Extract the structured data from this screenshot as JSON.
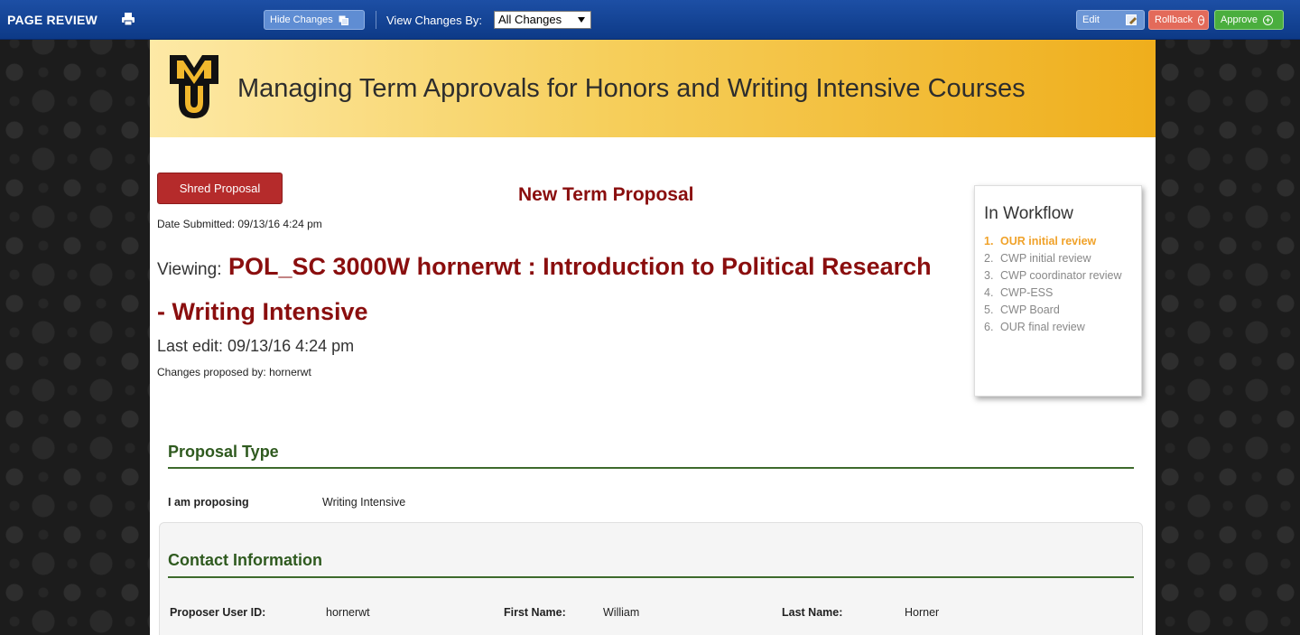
{
  "toolbar": {
    "title": "PAGE REVIEW",
    "hide_changes_label": "Hide Changes",
    "view_changes_label": "View Changes By:",
    "view_changes_selected": "All Changes",
    "edit_label": "Edit",
    "rollback_label": "Rollback",
    "approve_label": "Approve"
  },
  "banner": {
    "title": "Managing Term Approvals for Honors and Writing Intensive Courses"
  },
  "proposal": {
    "shred_label": "Shred Proposal",
    "heading": "New Term Proposal",
    "date_submitted": "Date Submitted: 09/13/16 4:24 pm",
    "viewing_label": "Viewing:",
    "viewing_title": "POL_SC 3000W hornerwt : Introduction to Political Research - Writing Intensive",
    "last_edit": "Last edit: 09/13/16 4:24 pm",
    "changes_by": "Changes proposed by: hornerwt"
  },
  "workflow": {
    "title": "In Workflow",
    "steps": [
      {
        "num": "1.",
        "label": "OUR initial review",
        "active": true
      },
      {
        "num": "2.",
        "label": "CWP initial review",
        "active": false
      },
      {
        "num": "3.",
        "label": "CWP coordinator review",
        "active": false
      },
      {
        "num": "4.",
        "label": "CWP-ESS",
        "active": false
      },
      {
        "num": "5.",
        "label": "CWP Board",
        "active": false
      },
      {
        "num": "6.",
        "label": "OUR final review",
        "active": false
      }
    ]
  },
  "proposal_type": {
    "heading": "Proposal Type",
    "label": "I am proposing",
    "value": "Writing Intensive"
  },
  "contact": {
    "heading": "Contact Information",
    "user_id_label": "Proposer User ID:",
    "user_id_value": "hornerwt",
    "first_name_label": "First Name:",
    "first_name_value": "William",
    "last_name_label": "Last Name:",
    "last_name_value": "Horner"
  },
  "colors": {
    "toolbar": "#0d3a87",
    "banner": "#efae1c",
    "proposal_red": "#8a0e0e",
    "section_green": "#2f5a1f",
    "workflow_active": "#f0a22a"
  }
}
